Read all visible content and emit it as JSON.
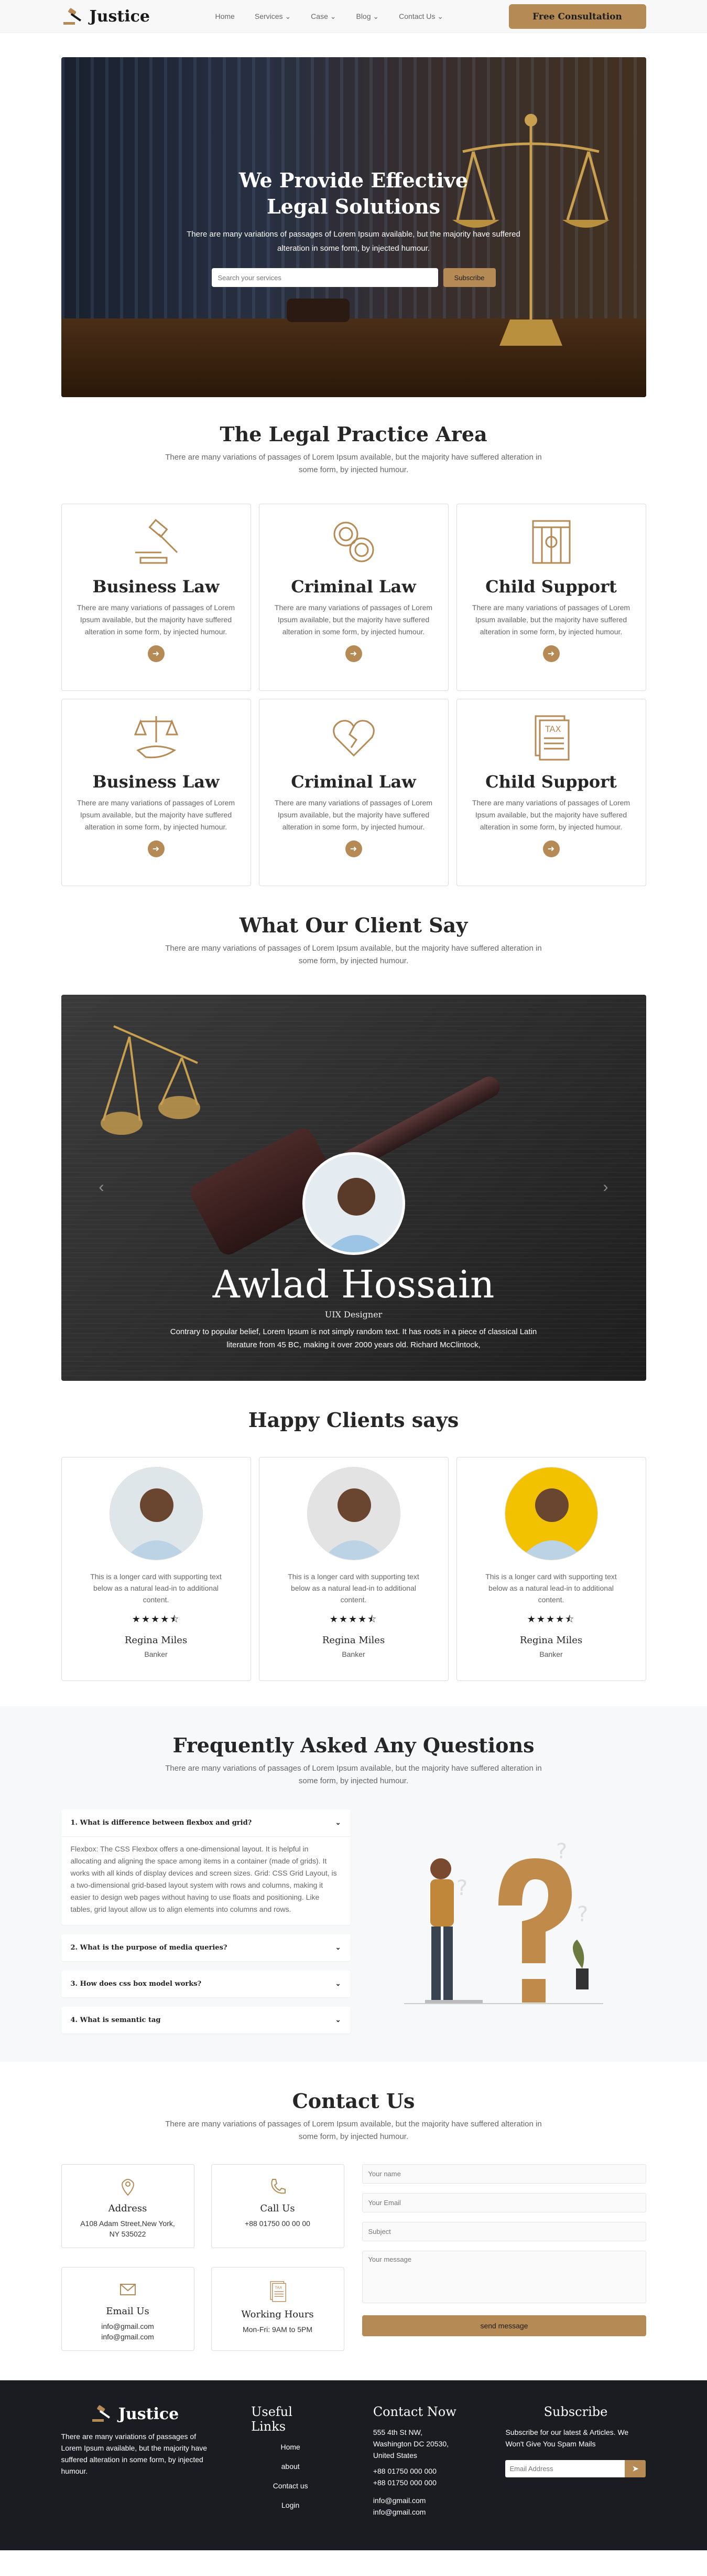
{
  "nav": {
    "brand": "Justice",
    "items": [
      "Home",
      "Services",
      "Case",
      "Blog",
      "Contact Us"
    ],
    "has_dropdown": [
      false,
      true,
      true,
      true,
      true
    ],
    "cta": "Free Consultation"
  },
  "hero": {
    "title_line1": "We Provide Effective",
    "title_line2": "Legal Solutions",
    "text": "There are many variations of passages of Lorem Ipsum available, but the majority have suffered alteration in some form, by injected humour.",
    "search_placeholder": "Search your services",
    "search_button": "Subscribe"
  },
  "practice": {
    "title": "The Legal Practice Area",
    "subtitle": "There are many variations of passages of Lorem Ipsum available, but the majority have suffered alteration in some form, by injected humour.",
    "cards": [
      {
        "title": "Business Law",
        "icon": "gavel-icon",
        "text": "There are many variations of passages of Lorem Ipsum available, but the majority have suffered alteration in some form, by injected humour."
      },
      {
        "title": "Criminal Law",
        "icon": "handcuffs-icon",
        "text": "There are many variations of passages of Lorem Ipsum available, but the majority have suffered alteration in some form, by injected humour."
      },
      {
        "title": "Child Support",
        "icon": "prison-icon",
        "text": "There are many variations of passages of Lorem Ipsum available, but the majority have suffered alteration in some form, by injected humour."
      },
      {
        "title": "Business Law",
        "icon": "scales-hand-icon",
        "text": "There are many variations of passages of Lorem Ipsum available, but the majority have suffered alteration in some form, by injected humour."
      },
      {
        "title": "Criminal Law",
        "icon": "broken-heart-icon",
        "text": "There are many variations of passages of Lorem Ipsum available, but the majority have suffered alteration in some form, by injected humour."
      },
      {
        "title": "Child Support",
        "icon": "tax-document-icon",
        "text": "There are many variations of passages of Lorem Ipsum available, but the majority have suffered alteration in some form, by injected humour."
      }
    ]
  },
  "client_say": {
    "title": "What Our Client Say",
    "subtitle": "There are many variations of passages of Lorem Ipsum available, but the majority have suffered alteration in some form, by injected humour.",
    "name": "Awlad Hossain",
    "role": "UIX Designer",
    "quote": "Contrary to popular belief, Lorem Ipsum is not simply random text. It has roots in a piece of classical Latin literature from 45 BC, making it over 2000 years old. Richard McClintock,"
  },
  "happy": {
    "title": "Happy Clients says",
    "cards": [
      {
        "text": "This is a longer card with supporting text below as a natural lead-in to additional content.",
        "stars": "★★★★⯪",
        "name": "Regina Miles",
        "role": "Banker",
        "bg": "#dfe6ea"
      },
      {
        "text": "This is a longer card with supporting text below as a natural lead-in to additional content.",
        "stars": "★★★★⯪",
        "name": "Regina Miles",
        "role": "Banker",
        "bg": "#e3e3e3"
      },
      {
        "text": "This is a longer card with supporting text below as a natural lead-in to additional content.",
        "stars": "★★★★⯪",
        "name": "Regina Miles",
        "role": "Banker",
        "bg": "#f2c200"
      }
    ]
  },
  "faq": {
    "title": "Frequently Asked Any Questions",
    "subtitle": "There are many variations of passages of Lorem Ipsum available, but the majority have suffered alteration in some form, by injected humour.",
    "items": [
      {
        "q": "1. What is difference between flexbox and grid?",
        "a": "Flexbox: The CSS Flexbox offers a one-dimensional layout. It is helpful in allocating and aligning the space among items in a container (made of grids). It works with all kinds of display devices and screen sizes. Grid: CSS Grid Layout, is a two-dimensional grid-based layout system with rows and columns, making it easier to design web pages without having to use floats and positioning. Like tables, grid layout allow us to align elements into columns and rows."
      },
      {
        "q": "2. What is the purpose of media queries?",
        "a": ""
      },
      {
        "q": "3. How does css box model works?",
        "a": ""
      },
      {
        "q": "4. What is semantic tag",
        "a": ""
      }
    ]
  },
  "contact": {
    "title": "Contact Us",
    "subtitle": "There are many variations of passages of Lorem Ipsum available, but the majority have suffered alteration in some form, by injected humour.",
    "boxes": [
      {
        "title": "Address",
        "value": "A108 Adam Street,New York, NY 535022",
        "icon": "location-pin-icon"
      },
      {
        "title": "Call Us",
        "value": "+88 01750 00 00 00",
        "icon": "phone-icon"
      },
      {
        "title": "Email Us",
        "value": "info@gmail.com info@gmail.com",
        "icon": "envelope-icon"
      },
      {
        "title": "Working Hours",
        "value": "Mon-Fri: 9AM to 5PM",
        "icon": "tax-document-icon"
      }
    ],
    "form": {
      "name_placeholder": "Your name",
      "email_placeholder": "Your Email",
      "subject_placeholder": "Subject",
      "message_placeholder": "Your message",
      "button": "send message"
    }
  },
  "footer": {
    "brand": "Justice",
    "about": "There are many variations of passages of Lorem Ipsum available, but the majority have suffered alteration in some form, by injected humour.",
    "links_title": "Useful Links",
    "links": [
      "Home",
      "about",
      "Contact us",
      "Login"
    ],
    "contact_title": "Contact Now",
    "address": "555 4th St NW, Washington DC 20530, United States",
    "phone1": "+88 01750 000 000",
    "phone2": "+88 01750 000 000",
    "email1": "info@gmail.com",
    "email2": "info@gmail.com",
    "subscribe_title": "Subscribe",
    "subscribe_text": "Subscribe for our latest & Articles. We Won't Give You Spam Mails",
    "email_placeholder": "Email Address"
  },
  "colors": {
    "accent": "#b58a55",
    "footer_bg": "#1a1c22"
  }
}
